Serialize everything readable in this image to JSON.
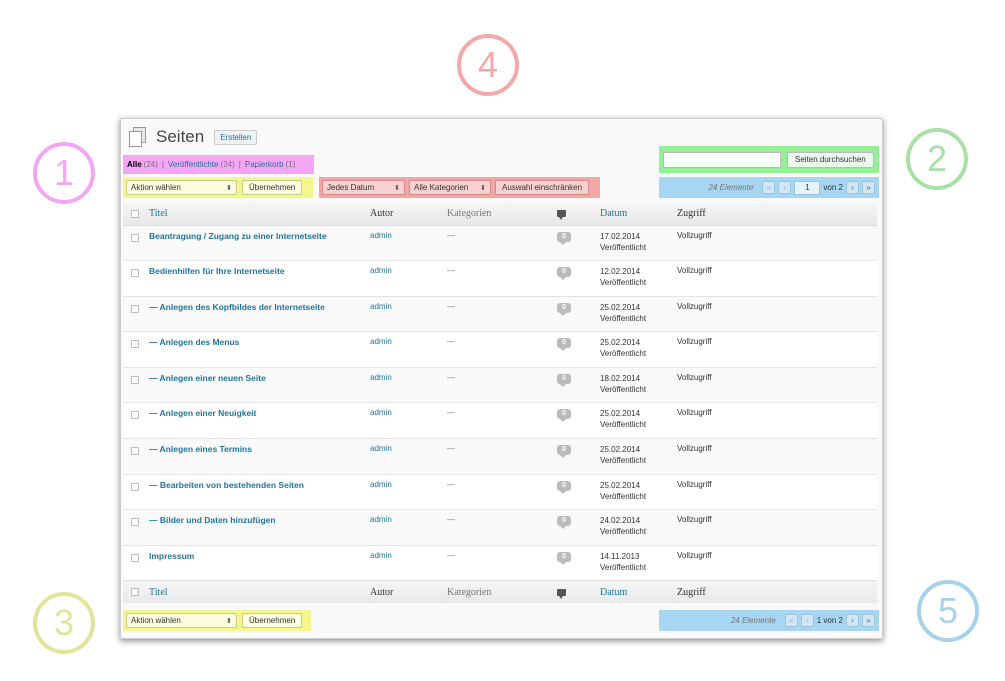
{
  "callouts": [
    "1",
    "2",
    "3",
    "4",
    "5"
  ],
  "header": {
    "title": "Seiten",
    "add_new": "Erstellen"
  },
  "views": {
    "all": {
      "label": "Alle",
      "count": "(24)"
    },
    "published": {
      "label": "Veröffentlichte",
      "count": "(24)"
    },
    "trash": {
      "label": "Papierkorb",
      "count": "(1)"
    },
    "separator": "|"
  },
  "search": {
    "button": "Seiten durchsuchen",
    "value": ""
  },
  "bulk": {
    "action": "Aktion wählen",
    "apply": "Übernehmen"
  },
  "filters": {
    "date": "Jedes Datum",
    "category": "Alle Kategorien",
    "submit": "Auswahl einschränken"
  },
  "pagination_top": {
    "items": "24 Elemente",
    "first": "«",
    "prev": "‹",
    "current": "1",
    "of": "von 2",
    "next": "›",
    "last": "»"
  },
  "pagination_bottom": {
    "items": "24 Elemente",
    "first": "«",
    "prev": "‹",
    "current": "1 von 2",
    "next": "›",
    "last": "»"
  },
  "columns": {
    "title": "Titel",
    "author": "Autor",
    "categories": "Kategorien",
    "date": "Datum",
    "access": "Zugriff"
  },
  "rows": [
    {
      "title": "Beantragung / Zugang zu einer Internetseite",
      "author": "admin",
      "categories": "—",
      "comments": "0",
      "date": "17.02.2014",
      "status": "Veröffentlicht",
      "access": "Vollzugriff"
    },
    {
      "title": "Bedienhilfen für Ihre Internetseite",
      "author": "admin",
      "categories": "—",
      "comments": "0",
      "date": "12.02.2014",
      "status": "Veröffentlicht",
      "access": "Vollzugriff"
    },
    {
      "title": "— Anlegen des Kopfbildes der Internetseite",
      "author": "admin",
      "categories": "—",
      "comments": "0",
      "date": "25.02.2014",
      "status": "Veröffentlicht",
      "access": "Vollzugriff"
    },
    {
      "title": "— Anlegen des Menus",
      "author": "admin",
      "categories": "—",
      "comments": "0",
      "date": "25.02.2014",
      "status": "Veröffentlicht",
      "access": "Vollzugriff"
    },
    {
      "title": "— Anlegen einer neuen Seite",
      "author": "admin",
      "categories": "—",
      "comments": "0",
      "date": "18.02.2014",
      "status": "Veröffentlicht",
      "access": "Vollzugriff"
    },
    {
      "title": "— Anlegen einer Neuigkeit",
      "author": "admin",
      "categories": "—",
      "comments": "0",
      "date": "25.02.2014",
      "status": "Veröffentlicht",
      "access": "Vollzugriff"
    },
    {
      "title": "— Anlegen eines Termins",
      "author": "admin",
      "categories": "—",
      "comments": "0",
      "date": "25.02.2014",
      "status": "Veröffentlicht",
      "access": "Vollzugriff"
    },
    {
      "title": "— Bearbeiten von bestehenden Seiten",
      "author": "admin",
      "categories": "—",
      "comments": "0",
      "date": "25.02.2014",
      "status": "Veröffentlicht",
      "access": "Vollzugriff"
    },
    {
      "title": "— Bilder und Daten hinzufügen",
      "author": "admin",
      "categories": "—",
      "comments": "0",
      "date": "24.02.2014",
      "status": "Veröffentlicht",
      "access": "Vollzugriff"
    },
    {
      "title": "Impressum",
      "author": "admin",
      "categories": "—",
      "comments": "0",
      "date": "14.11.2013",
      "status": "Veröffentlicht",
      "access": "Vollzugriff"
    }
  ]
}
